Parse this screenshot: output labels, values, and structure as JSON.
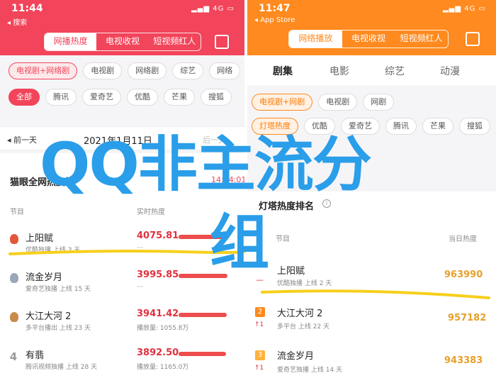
{
  "left": {
    "time": "11:44",
    "back": "◂ 搜索",
    "status_icons": "4G",
    "tabs": [
      "网播热度",
      "电视收视",
      "短视频红人"
    ],
    "categories": [
      "电视剧+网络剧",
      "电视剧",
      "网络剧",
      "综艺",
      "网络"
    ],
    "platforms": [
      "全部",
      "腾讯",
      "爱奇艺",
      "优酷",
      "芒果",
      "搜狐"
    ],
    "prev_day": "◂ 前一天",
    "date": "2021年1月11日",
    "next_day": "后一天",
    "board_title": "猫眼全网热度榜",
    "board_time": "14:44:01",
    "col_program": "节目",
    "col_heat": "实时热度",
    "rows": [
      {
        "title": "上阳赋",
        "sub": "优酷独播  上线 3 天",
        "value": "4075.81",
        "sub2": "···",
        "heat": 1.0
      },
      {
        "title": "流金岁月",
        "sub": "爱奇艺独播  上线 15 天",
        "value": "3995.85",
        "sub2": "···",
        "heat": 0.98
      },
      {
        "title": "大江大河 2",
        "sub": "多平台播出  上线 23 天",
        "value": "3941.42",
        "sub2": "播放量: 1055.8万",
        "heat": 0.97
      },
      {
        "title": "有翡",
        "sub": "腾讯视频独播  上线 28 天",
        "value": "3892.50",
        "sub2": "播放量: 1165.0万",
        "heat": 0.955
      }
    ],
    "rank4_label": "4"
  },
  "right": {
    "time": "11:47",
    "back": "◂ App Store",
    "status_icons": "4G",
    "tabs": [
      "网络播放",
      "电视收视",
      "短视频红人"
    ],
    "types": [
      "剧集",
      "电影",
      "综艺",
      "动漫"
    ],
    "categories": [
      "电视剧+网剧",
      "电视剧",
      "网剧"
    ],
    "platforms": [
      "灯塔热度",
      "优酷",
      "爱奇艺",
      "腾讯",
      "芒果",
      "搜狐"
    ],
    "board_title": "灯塔热度排名",
    "col_program": "节目",
    "col_heat": "当日热度",
    "rows": [
      {
        "rank": "—",
        "title": "上阳赋",
        "sub": "优酷独播  上线 2 天",
        "value": "963990",
        "change": ""
      },
      {
        "rank": "2",
        "title": "大江大河 2",
        "sub": "多平台  上线 22 天",
        "value": "957182",
        "change": "↑1"
      },
      {
        "rank": "3",
        "title": "流金岁月",
        "sub": "爱奇艺独播  上线 14 天",
        "value": "943383",
        "change": "↑1"
      }
    ]
  },
  "watermark": {
    "line1": "QQ非主流分",
    "line2": "组"
  },
  "colors": {
    "left_brand": "#f2445a",
    "right_brand": "#ff8a1f",
    "watermark": "#2a9ee9",
    "underline": "#f7cf1c"
  }
}
